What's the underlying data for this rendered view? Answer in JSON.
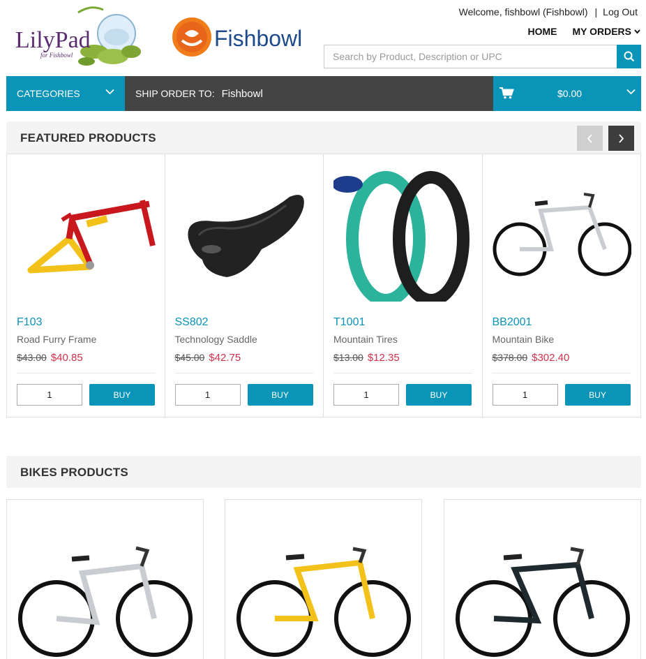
{
  "header": {
    "welcome_text": "Welcome, fishbowl (Fishbowl)",
    "separator": "|",
    "logout_label": "Log Out",
    "nav": {
      "home_label": "HOME",
      "orders_label": "MY ORDERS"
    },
    "search": {
      "placeholder": "Search by Product, Description or UPC"
    },
    "lilypad_logo_text": "LilyPad",
    "lilypad_logo_sub": "for Fishbowl",
    "fishbowl_logo_text": "Fishbowl"
  },
  "bar": {
    "categories_label": "CATEGORIES",
    "ship_label": "SHIP ORDER TO:",
    "ship_value": "Fishbowl",
    "cart_total": "$0.00"
  },
  "featured": {
    "title": "FEATURED PRODUCTS",
    "products": [
      {
        "sku": "F103",
        "name": "Road Furry Frame",
        "old_price": "$43.00",
        "price": "$40.85",
        "qty": "1",
        "buy_label": "BUY",
        "image": "bike-frame"
      },
      {
        "sku": "SS802",
        "name": "Technology Saddle",
        "old_price": "$45.00",
        "price": "$42.75",
        "qty": "1",
        "buy_label": "BUY",
        "image": "saddle"
      },
      {
        "sku": "T1001",
        "name": "Mountain Tires",
        "old_price": "$13.00",
        "price": "$12.35",
        "qty": "1",
        "buy_label": "BUY",
        "image": "tires"
      },
      {
        "sku": "BB2001",
        "name": "Mountain Bike",
        "old_price": "$378.00",
        "price": "$302.40",
        "qty": "1",
        "buy_label": "BUY",
        "image": "mountain-bike"
      }
    ]
  },
  "bikes": {
    "title": "BIKES PRODUCTS",
    "products": [
      {
        "image": "silver-bike"
      },
      {
        "image": "yellow-bike"
      },
      {
        "image": "black-bike"
      }
    ]
  },
  "colors": {
    "accent": "#0a94b8",
    "dark_bar": "#444444",
    "sale_price": "#d0314d"
  }
}
